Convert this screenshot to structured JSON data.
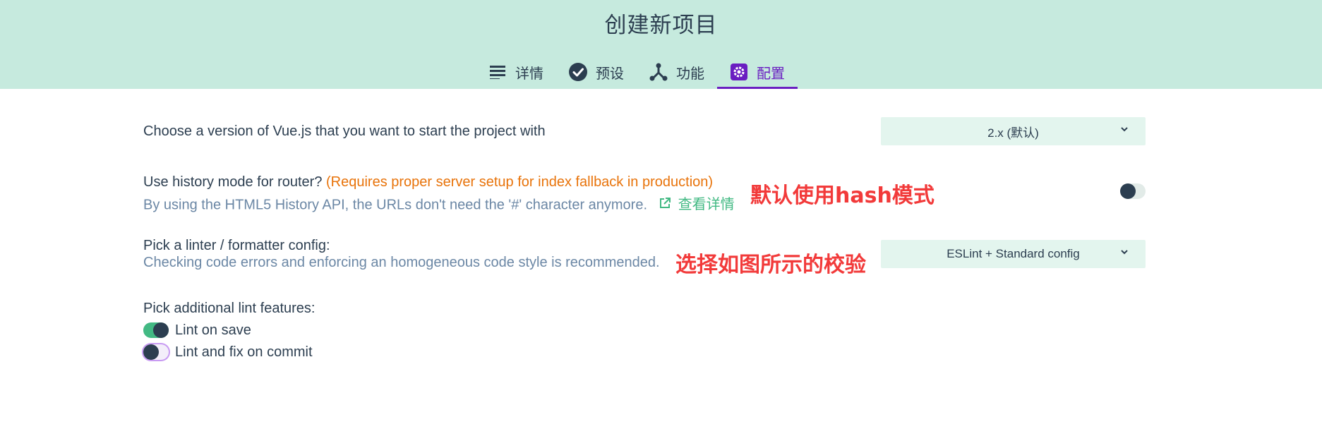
{
  "page": {
    "title": "创建新项目"
  },
  "tabs": [
    {
      "label": "详情",
      "icon": "list-icon"
    },
    {
      "label": "预设",
      "icon": "check-circle-icon"
    },
    {
      "label": "功能",
      "icon": "fork-icon"
    },
    {
      "label": "配置",
      "icon": "settings-icon",
      "active": true
    }
  ],
  "vue_version": {
    "label": "Choose a version of Vue.js that you want to start the project with",
    "selected": "2.x (默认)"
  },
  "router": {
    "label": "Use history mode for router?",
    "warning": "(Requires proper server setup for index fallback in production)",
    "description": "By using the HTML5 History API, the URLs don't need the '#' character anymore.",
    "link_label": "查看详情",
    "enabled": false
  },
  "linter": {
    "label": "Pick a linter / formatter config:",
    "description": "Checking code errors and enforcing an homogeneous code style is recommended.",
    "selected": "ESLint + Standard config"
  },
  "lint_features": {
    "label": "Pick additional lint features:",
    "options": [
      {
        "label": "Lint on save",
        "enabled": true
      },
      {
        "label": "Lint and fix on commit",
        "enabled": false
      }
    ]
  },
  "annotations": {
    "router_note": "默认使用hash模式",
    "linter_note": "选择如图所示的校验"
  },
  "colors": {
    "header_bg": "#c6eade",
    "accent": "#6a1ec1",
    "green": "#42b983",
    "warning": "#e8730a",
    "annotation": "#f23a3a"
  }
}
